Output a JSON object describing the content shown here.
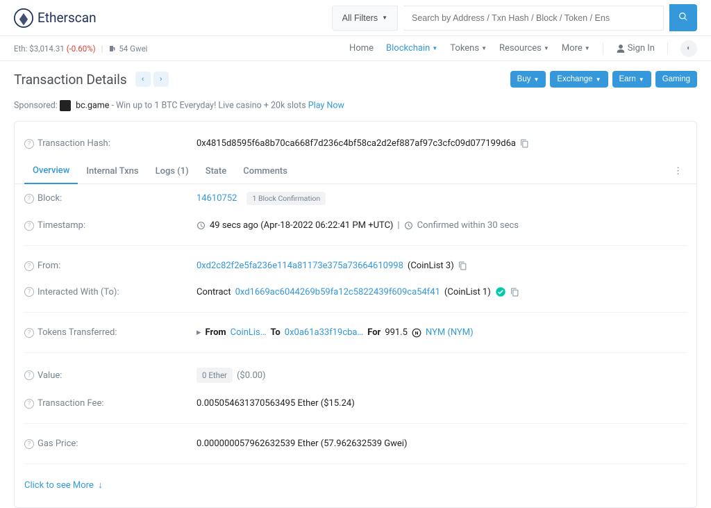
{
  "brand": "Etherscan",
  "filters_label": "All Filters",
  "search_placeholder": "Search by Address / Txn Hash / Block / Token / Ens",
  "stats": {
    "eth_label": "Eth:",
    "eth_price": "$3,014.31",
    "eth_change": "(-0.60%)",
    "gas": "54 Gwei"
  },
  "nav": {
    "home": "Home",
    "blockchain": "Blockchain",
    "tokens": "Tokens",
    "resources": "Resources",
    "more": "More",
    "signin": "Sign In"
  },
  "page_title": "Transaction Details",
  "actions": {
    "buy": "Buy",
    "exchange": "Exchange",
    "earn": "Earn",
    "gaming": "Gaming"
  },
  "sponsor": {
    "prefix": "Sponsored:",
    "name": "bc.game",
    "text": "- Win up to 1 BTC Everyday! Live casino + 20k slots",
    "cta": "Play Now"
  },
  "labels": {
    "hash": "Transaction Hash:",
    "block": "Block:",
    "timestamp": "Timestamp:",
    "from": "From:",
    "to": "Interacted With (To):",
    "tokens": "Tokens Transferred:",
    "value": "Value:",
    "fee": "Transaction Fee:",
    "gas": "Gas Price:"
  },
  "tabs": {
    "overview": "Overview",
    "internal": "Internal Txns",
    "logs": "Logs (1)",
    "state": "State",
    "comments": "Comments"
  },
  "tx": {
    "hash": "0x4815d8595f6a8b70ca668f7d236c4bf58ca2d2ef887af97c3cfc09d077199d6a",
    "block": "14610752",
    "confirmations": "1 Block Confirmation",
    "age": "49 secs ago (Apr-18-2022 06:22:41 PM +UTC)",
    "confirmed_in": "Confirmed within 30 secs",
    "from_addr": "0xd2c82f2e5fa236e114a81173e375a73664610998",
    "from_name": "(CoinList 3)",
    "to_prefix": "Contract",
    "to_addr": "0xd1669ac6044269b59fa12c5822439f609ca54f41",
    "to_name": "(CoinList 1)",
    "tt_from_label": "From",
    "tt_from_name": "CoinLis…",
    "tt_to_label": "To",
    "tt_to_addr": "0x0a61a33f19cba…",
    "tt_for_label": "For",
    "tt_amount": "991.5",
    "tt_token": "NYM (NYM)",
    "value_pill": "0 Ether",
    "value_usd": "($0.00)",
    "fee": "0.005054631370563495 Ether ($15.24)",
    "gas": "0.000000057962632539 Ether (57.962632539 Gwei)"
  },
  "see_more": "Click to see More"
}
